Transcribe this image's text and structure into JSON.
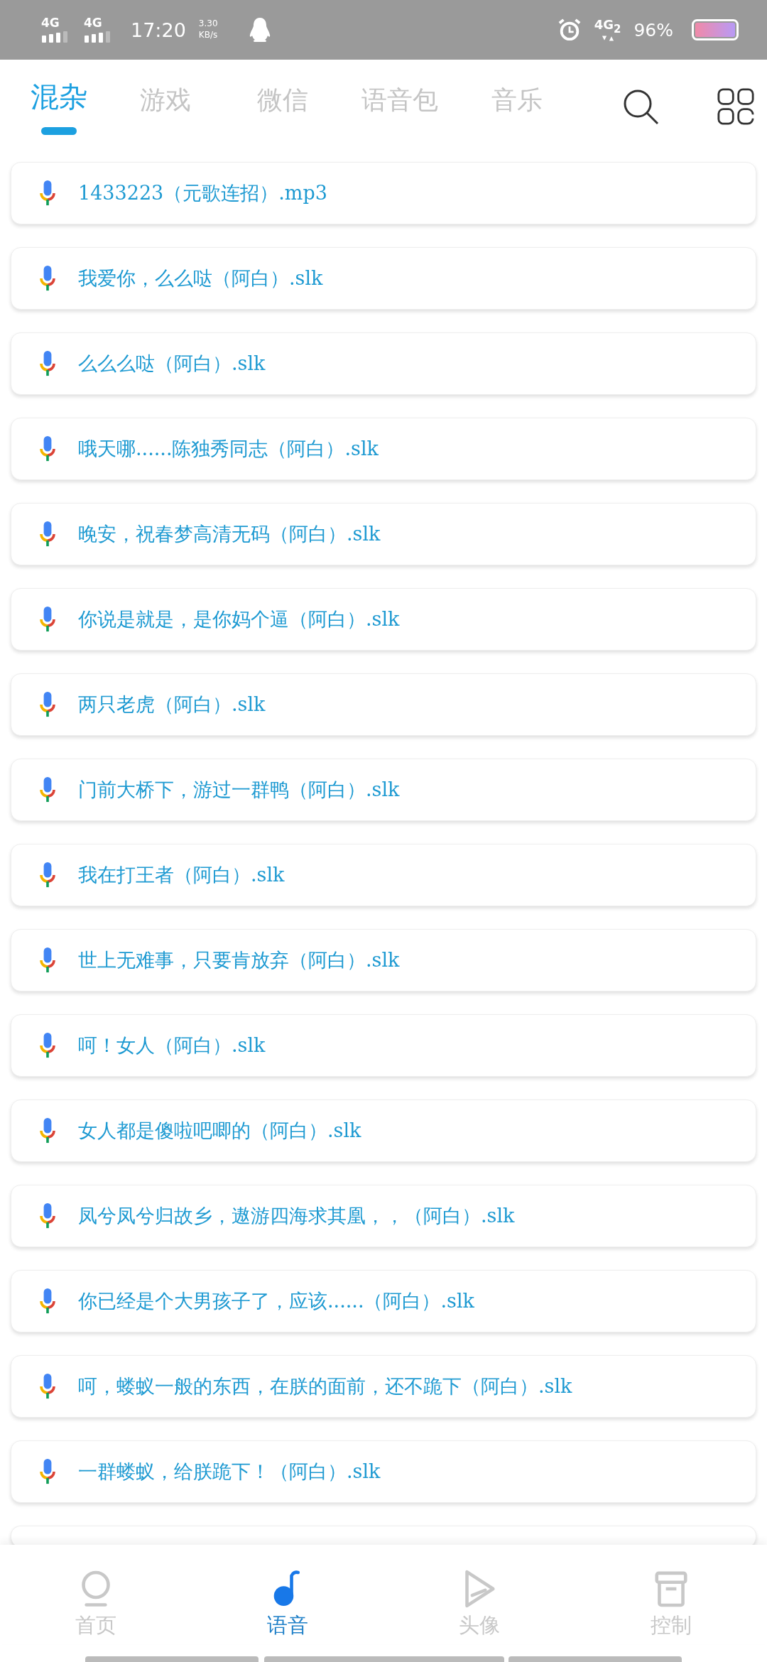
{
  "status_bar": {
    "sim_1": "4G",
    "sim_2": "4G",
    "time": "17:20",
    "net_speed": "3.30",
    "net_speed_unit": "KB/s",
    "network": "4G$_{2}$",
    "battery": "96%"
  },
  "tabs": [
    {
      "label": "混杂",
      "selected": true
    },
    {
      "label": "游戏",
      "selected": false
    },
    {
      "label": "微信",
      "selected": false
    },
    {
      "label": "语音包",
      "selected": false
    },
    {
      "label": "音乐",
      "selected": false
    }
  ],
  "files": [
    "1433223（元歌连招）.mp3",
    "我爱你，么么哒（阿白）.slk",
    "么么么哒（阿白）.slk",
    "哦天哪......陈独秀同志（阿白）.slk",
    "晚安，祝春梦高清无码（阿白）.slk",
    "你说是就是，是你妈个逼（阿白）.slk",
    "两只老虎（阿白）.slk",
    "门前大桥下，游过一群鸭（阿白）.slk",
    "我在打王者（阿白）.slk",
    "世上无难事，只要肯放弃（阿白）.slk",
    "呵！女人（阿白）.slk",
    "女人都是傻啦吧唧的（阿白）.slk",
    "凤兮凤兮归故乡，遨游四海求其凰，，（阿白）.slk",
    "你已经是个大男孩子了，应该......（阿白）.slk",
    "呵，蝼蚁一般的东西，在朕的面前，还不跪下（阿白）.slk",
    "一群蝼蚁，给朕跪下！（阿白）.slk"
  ],
  "bottom_nav": [
    {
      "kind": "home",
      "label": "首页",
      "selected": false
    },
    {
      "kind": "voice",
      "label": "语音",
      "selected": true
    },
    {
      "kind": "avatar",
      "label": "头像",
      "selected": false
    },
    {
      "kind": "control",
      "label": "控制",
      "selected": false
    }
  ]
}
